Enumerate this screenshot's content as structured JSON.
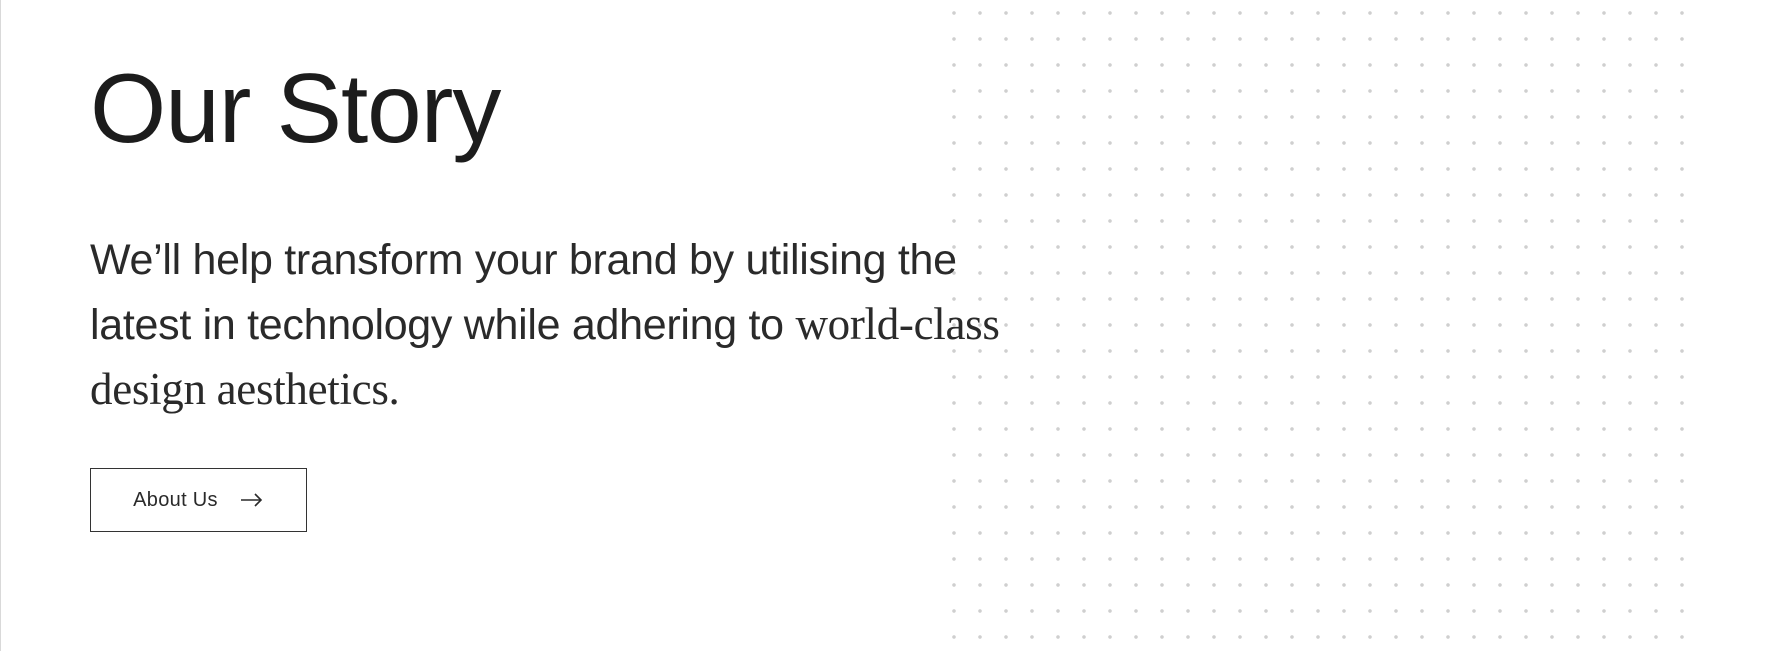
{
  "section": {
    "title": "Our Story",
    "lead_sans": "We’ll help transform your brand by utilising the latest in technology while adhering to ",
    "lead_serif": "world-class design aesthetics."
  },
  "button": {
    "label": "About Us",
    "icon": "arrow-right-icon"
  }
}
